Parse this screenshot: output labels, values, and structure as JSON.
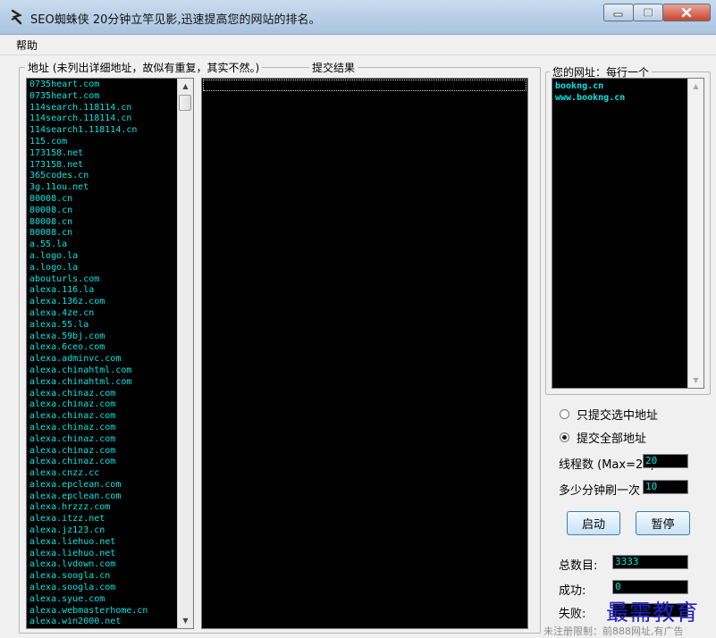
{
  "window": {
    "title": "SEO蜘蛛侠  20分钟立竿见影,迅速提高您的网站的排名。",
    "app_icon": "spider-app-icon",
    "controls": [
      "minimize-icon",
      "maximize-icon",
      "close-icon"
    ]
  },
  "menu": {
    "help_label": "帮助"
  },
  "addresses": {
    "label": "地址 (未列出详细地址，故似有重复，其实不然。)",
    "items": [
      "0735heart.com",
      "0735heart.com",
      "114search.118114.cn",
      "114search.118114.cn",
      "114search1.118114.cn",
      "115.com",
      "173158.net",
      "173158.net",
      "365codes.cn",
      "3g.11ou.net",
      "80008.cn",
      "80008.cn",
      "80008.cn",
      "80008.cn",
      "a.55.la",
      "a.logo.la",
      "a.logo.la",
      "abouturls.com",
      "alexa.116.la",
      "alexa.136z.com",
      "alexa.4ze.cn",
      "alexa.55.la",
      "alexa.59bj.com",
      "alexa.6ceo.com",
      "alexa.adminvc.com",
      "alexa.chinahtml.com",
      "alexa.chinahtml.com",
      "alexa.chinaz.com",
      "alexa.chinaz.com",
      "alexa.chinaz.com",
      "alexa.chinaz.com",
      "alexa.chinaz.com",
      "alexa.chinaz.com",
      "alexa.chinaz.com",
      "alexa.cnzz.cc",
      "alexa.epclean.com",
      "alexa.epclean.com",
      "alexa.hrzzz.com",
      "alexa.itzz.net",
      "alexa.jz123.cn",
      "alexa.liehuo.net",
      "alexa.liehuo.net",
      "alexa.lvdown.com",
      "alexa.soogla.cn",
      "alexa.soogla.com",
      "alexa.syue.com",
      "alexa.webmasterhome.cn",
      "alexa.win2000.net"
    ]
  },
  "results": {
    "label": "提交结果"
  },
  "your_urls": {
    "label": "您的网址：每行一个",
    "items": [
      "bookng.cn",
      "www.bookng.cn"
    ]
  },
  "options": {
    "submit_selected": "只提交选中地址",
    "submit_all": "提交全部地址",
    "selected": "submit_all"
  },
  "settings": {
    "threads_label": "线程数 (Max=20):",
    "threads_value": "20",
    "interval_label": "多少分钟刷一次",
    "interval_value": "10"
  },
  "buttons": {
    "start": "启动",
    "pause": "暂停"
  },
  "stats": {
    "total_label": "总数目:",
    "total_value": "3333",
    "success_label": "成功:",
    "success_value": "0",
    "fail_label": "失败:",
    "fail_value": ""
  },
  "footer": {
    "note": "未注册限制：前888网址,有广告"
  },
  "watermark": {
    "text": "最需教育"
  }
}
